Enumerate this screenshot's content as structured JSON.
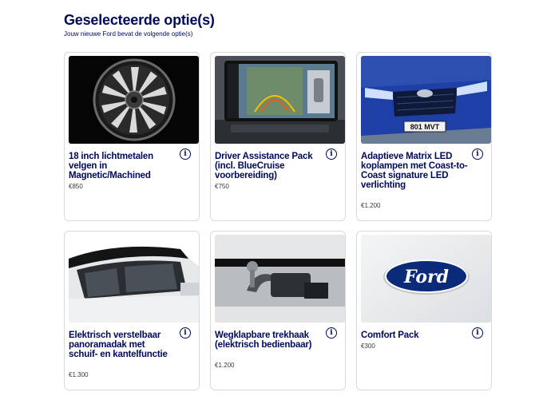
{
  "header": {
    "title": "Geselecteerde optie(s)",
    "subtitle": "Jouw nieuwe Ford bevat de volgende optie(s)"
  },
  "options": [
    {
      "name": "18 inch lichtmetalen velgen in Magnetic/Machined",
      "price": "€850",
      "image": "alloy-wheel"
    },
    {
      "name": "Driver Assistance Pack (incl. BlueCruise voorbereiding)",
      "price": "€750",
      "image": "infotainment-screen"
    },
    {
      "name": "Adaptieve Matrix LED koplampen met Coast-to-Coast signature LED verlichting",
      "price": "€1.200",
      "image": "car-front-blue"
    },
    {
      "name": "Elektrisch verstelbaar panoramadak met schuif- en kantelfunctie",
      "price": "€1.300",
      "image": "panoramic-roof"
    },
    {
      "name": "Wegklapbare trekhaak (elektrisch bedienbaar)",
      "price": "€1.200",
      "image": "tow-hitch"
    },
    {
      "name": "Comfort Pack",
      "price": "€300",
      "image": "ford-logo"
    }
  ],
  "info_icon_glyph": "i",
  "logo_text": "Ford",
  "plate_text": "801 MVT",
  "colors": {
    "brand": "#00095b",
    "card_border": "#d9d9d9"
  }
}
